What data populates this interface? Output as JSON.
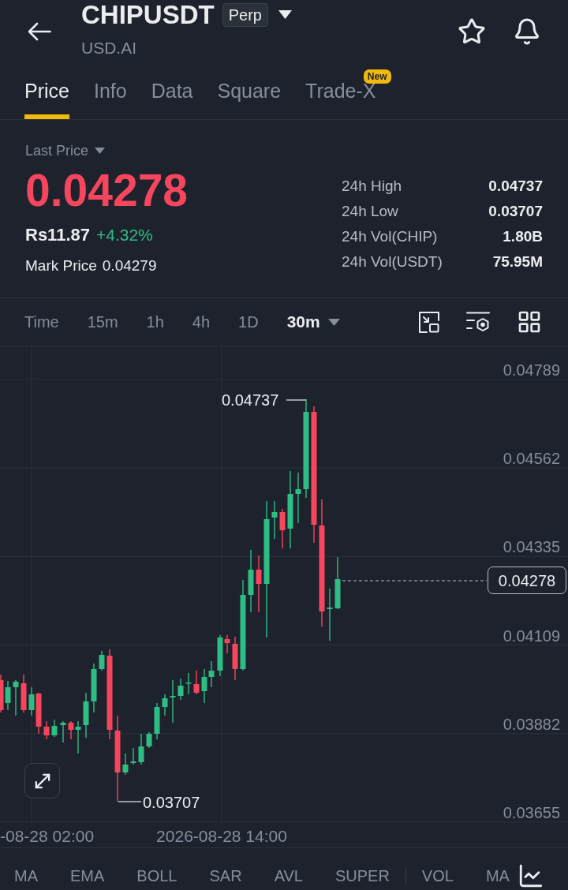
{
  "header": {
    "title": "CHIPUSDT",
    "badge": "Perp",
    "subtitle": "USD.AI"
  },
  "tabs": [
    {
      "label": "Price",
      "selected": true
    },
    {
      "label": "Info",
      "selected": false
    },
    {
      "label": "Data",
      "selected": false
    },
    {
      "label": "Square",
      "selected": false
    },
    {
      "label": "Trade-X",
      "selected": false,
      "badge": "New"
    }
  ],
  "price": {
    "label": "Last Price",
    "value": "0.04278",
    "value_falling": true,
    "fiat": "Rs11.87",
    "change": "+4.32%",
    "change_rising": true,
    "mark_label": "Mark Price",
    "mark_value": "0.04279"
  },
  "stats": [
    {
      "label": "24h High",
      "value": "0.04737"
    },
    {
      "label": "24h Low",
      "value": "0.03707"
    },
    {
      "label": "24h Vol(CHIP)",
      "value": "1.80B"
    },
    {
      "label": "24h Vol(USDT)",
      "value": "75.95M"
    }
  ],
  "intervals": [
    {
      "label": "Time",
      "selected": false
    },
    {
      "label": "15m",
      "selected": false
    },
    {
      "label": "1h",
      "selected": false
    },
    {
      "label": "4h",
      "selected": false
    },
    {
      "label": "1D",
      "selected": false
    },
    {
      "label": "30m",
      "selected": true
    }
  ],
  "chart": {
    "y_axis": [
      "0.04789",
      "0.04562",
      "0.04335",
      "0.04109",
      "0.03882",
      "0.03655"
    ],
    "high_label": "0.04737",
    "low_label": "0.03707",
    "current_price": "0.04278",
    "x_axis": [
      "-08-28 02:00",
      "2026-08-28 14:00"
    ]
  },
  "indicators": {
    "main": [
      "MA",
      "EMA",
      "BOLL",
      "SAR",
      "AVL",
      "SUPER"
    ],
    "sub": [
      "VOL",
      "MA"
    ]
  }
}
